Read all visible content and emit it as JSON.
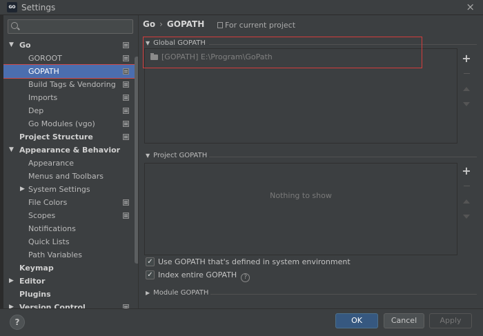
{
  "window": {
    "title": "Settings",
    "app_icon_text": "GO"
  },
  "search": {
    "placeholder": ""
  },
  "sidebar": {
    "items": [
      {
        "label": "Go",
        "bold": true,
        "level": 0,
        "arrow": "down",
        "proj": true
      },
      {
        "label": "GOROOT",
        "level": 1,
        "proj": true
      },
      {
        "label": "GOPATH",
        "level": 1,
        "proj": true,
        "selected": true
      },
      {
        "label": "Build Tags & Vendoring",
        "level": 1,
        "proj": true
      },
      {
        "label": "Imports",
        "level": 1,
        "proj": true
      },
      {
        "label": "Dep",
        "level": 1,
        "proj": true
      },
      {
        "label": "Go Modules (vgo)",
        "level": 1,
        "proj": true
      },
      {
        "label": "Project Structure",
        "bold": true,
        "level": 0,
        "proj": true
      },
      {
        "label": "Appearance & Behavior",
        "bold": true,
        "level": 0,
        "arrow": "down"
      },
      {
        "label": "Appearance",
        "level": 1
      },
      {
        "label": "Menus and Toolbars",
        "level": 1
      },
      {
        "label": "System Settings",
        "level": 1,
        "arrow": "right"
      },
      {
        "label": "File Colors",
        "level": 1,
        "proj": true
      },
      {
        "label": "Scopes",
        "level": 1,
        "proj": true
      },
      {
        "label": "Notifications",
        "level": 1
      },
      {
        "label": "Quick Lists",
        "level": 1
      },
      {
        "label": "Path Variables",
        "level": 1
      },
      {
        "label": "Keymap",
        "bold": true,
        "level": 0
      },
      {
        "label": "Editor",
        "bold": true,
        "level": 0,
        "arrow": "right"
      },
      {
        "label": "Plugins",
        "bold": true,
        "level": 0
      },
      {
        "label": "Version Control",
        "bold": true,
        "level": 0,
        "arrow": "right",
        "proj": true
      }
    ]
  },
  "content": {
    "breadcrumb": {
      "parent": "Go",
      "separator": "›",
      "current": "GOPATH"
    },
    "scope_label": "For current project",
    "global_section": {
      "title": "Global GOPATH",
      "entries": [
        "[GOPATH] E:\\Program\\GoPath"
      ]
    },
    "project_section": {
      "title": "Project GOPATH",
      "empty_text": "Nothing to show"
    },
    "options": {
      "use_system_gopath": {
        "label": "Use GOPATH that's defined in system environment",
        "checked": true
      },
      "index_entire_gopath": {
        "label": "Index entire GOPATH",
        "checked": true
      }
    },
    "module_section": {
      "title": "Module GOPATH"
    },
    "side_buttons": {
      "add": "+",
      "remove": "−"
    }
  },
  "footer": {
    "help": "?",
    "ok": "OK",
    "cancel": "Cancel",
    "apply": "Apply"
  },
  "colors": {
    "background": "#3c3f41",
    "selection": "#4b6eaf",
    "ok_button": "#365880",
    "highlight_box": "#d43c3c"
  }
}
